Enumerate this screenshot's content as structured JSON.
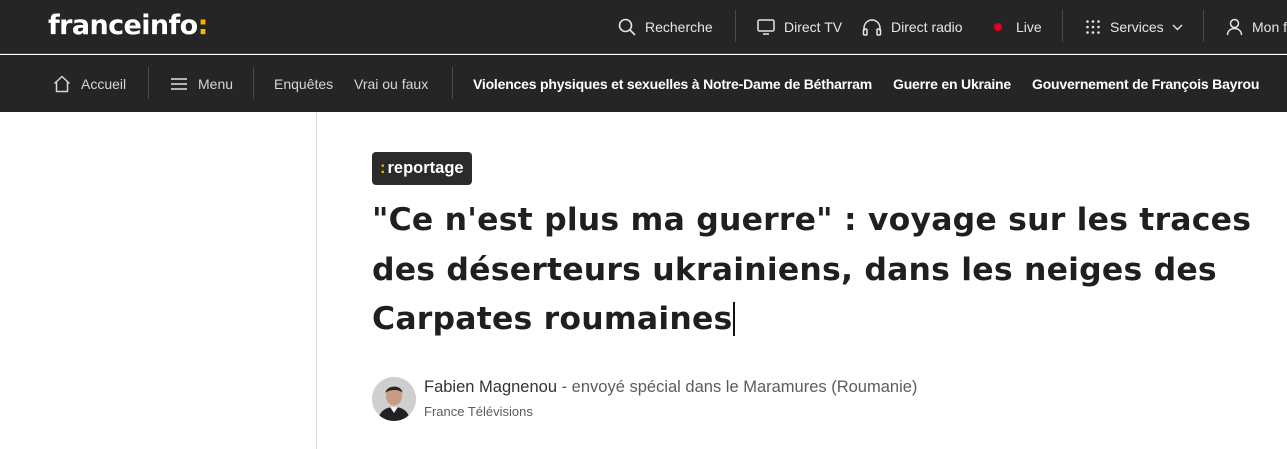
{
  "brand": {
    "name": "franceinfo",
    "colon": ":",
    "accent_color": "#f7b500"
  },
  "topbar": {
    "search_label": "Recherche",
    "direct_tv_label": "Direct TV",
    "direct_radio_label": "Direct radio",
    "live_label": "Live",
    "live_color": "#e4001b",
    "services_label": "Services",
    "account_label": "Mon f"
  },
  "nav": {
    "home_label": "Accueil",
    "menu_label": "Menu",
    "items": [
      "Enquêtes",
      "Vrai ou faux"
    ],
    "topics": [
      "Violences physiques et sexuelles à Notre-Dame de Bétharram",
      "Guerre en Ukraine",
      "Gouvernement de François Bayrou"
    ]
  },
  "article": {
    "badge_colon": ":",
    "badge_label": "reportage",
    "headline": "\"Ce n'est plus ma guerre\" : voyage sur les traces des déserteurs ukrainiens, dans les neiges des Carpates roumaines",
    "author_name": "Fabien Magnenou",
    "author_role": " - envoyé spécial dans le Maramures (Roumanie)",
    "organization": "France Télévisions"
  },
  "icons": {
    "search": "search-icon",
    "tv": "tv-icon",
    "headphones": "headphones-icon",
    "grid": "grid-icon",
    "chevron": "chevron-down-icon",
    "user": "user-icon",
    "home": "home-icon",
    "menu": "hamburger-icon"
  }
}
